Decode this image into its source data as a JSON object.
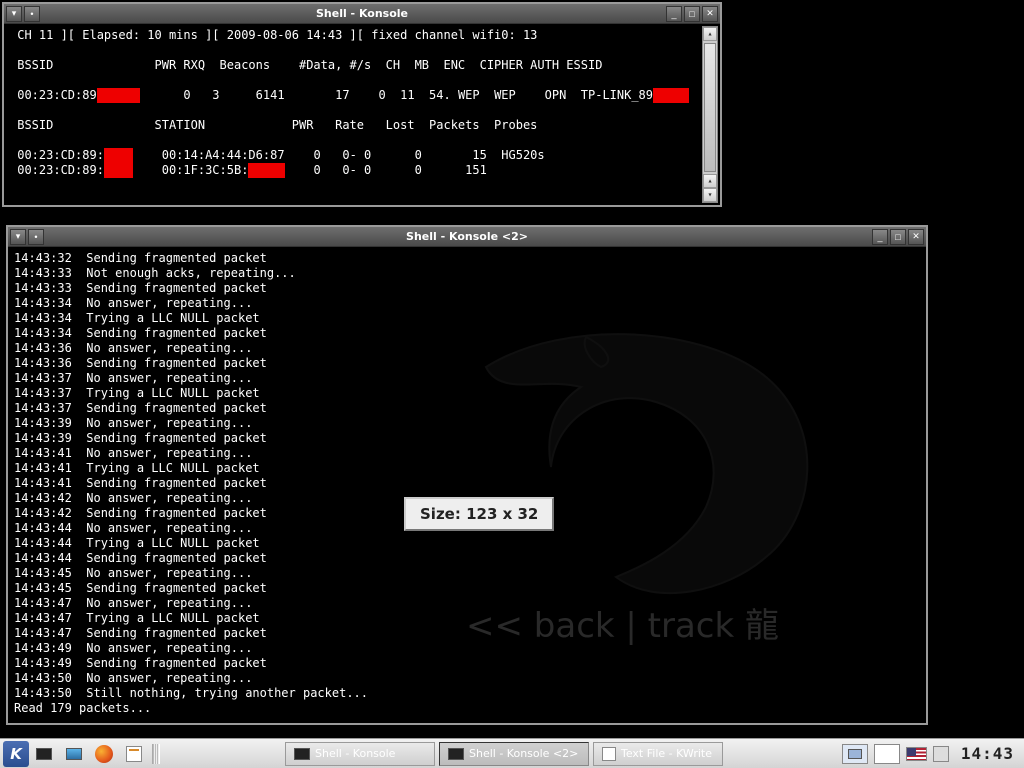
{
  "window1": {
    "title": "Shell - Konsole",
    "status_line": " CH 11 ][ Elapsed: 10 mins ][ 2009-08-06 14:43 ][ fixed channel wifi0: 13",
    "header1": " BSSID              PWR RXQ  Beacons    #Data, #/s  CH  MB  ENC  CIPHER AUTH ESSID",
    "ap_pre": " 00:23:CD:89",
    "ap_mid": "      0   3     6141       17    0  11  54. WEP  WEP    OPN  TP-LINK_89",
    "header2": " BSSID              STATION            PWR   Rate   Lost  Packets  Probes",
    "c1_pre": " 00:23:CD:89:",
    "c1_mid": "    00:14:A4:44:D6:87    0   0- 0      0       15  HG520s",
    "c2_pre": " 00:23:CD:89:",
    "c2_mid": "    00:1F:3C:5B:",
    "c2_post": "    0   0- 0      0      151"
  },
  "window2": {
    "title": "Shell - Konsole <2>",
    "size_tip": "Size: 123 x 32",
    "bt_text": "<< back | track 龍",
    "lines": [
      "14:43:32  Sending fragmented packet",
      "14:43:33  Not enough acks, repeating...",
      "14:43:33  Sending fragmented packet",
      "14:43:34  No answer, repeating...",
      "14:43:34  Trying a LLC NULL packet",
      "14:43:34  Sending fragmented packet",
      "14:43:36  No answer, repeating...",
      "14:43:36  Sending fragmented packet",
      "14:43:37  No answer, repeating...",
      "14:43:37  Trying a LLC NULL packet",
      "14:43:37  Sending fragmented packet",
      "14:43:39  No answer, repeating...",
      "14:43:39  Sending fragmented packet",
      "14:43:41  No answer, repeating...",
      "14:43:41  Trying a LLC NULL packet",
      "14:43:41  Sending fragmented packet",
      "14:43:42  No answer, repeating...",
      "14:43:42  Sending fragmented packet",
      "14:43:44  No answer, repeating...",
      "14:43:44  Trying a LLC NULL packet",
      "14:43:44  Sending fragmented packet",
      "14:43:45  No answer, repeating...",
      "14:43:45  Sending fragmented packet",
      "14:43:47  No answer, repeating...",
      "14:43:47  Trying a LLC NULL packet",
      "14:43:47  Sending fragmented packet",
      "14:43:49  No answer, repeating...",
      "14:43:49  Sending fragmented packet",
      "14:43:50  No answer, repeating...",
      "14:43:50  Still nothing, trying another packet...",
      "Read 179 packets..."
    ]
  },
  "taskbar": {
    "tasks": [
      {
        "label": "Shell - Konsole"
      },
      {
        "label": "Shell - Konsole <2>"
      },
      {
        "label": "Text File - KWrite"
      }
    ],
    "pager": "2",
    "clock": "14:43"
  }
}
